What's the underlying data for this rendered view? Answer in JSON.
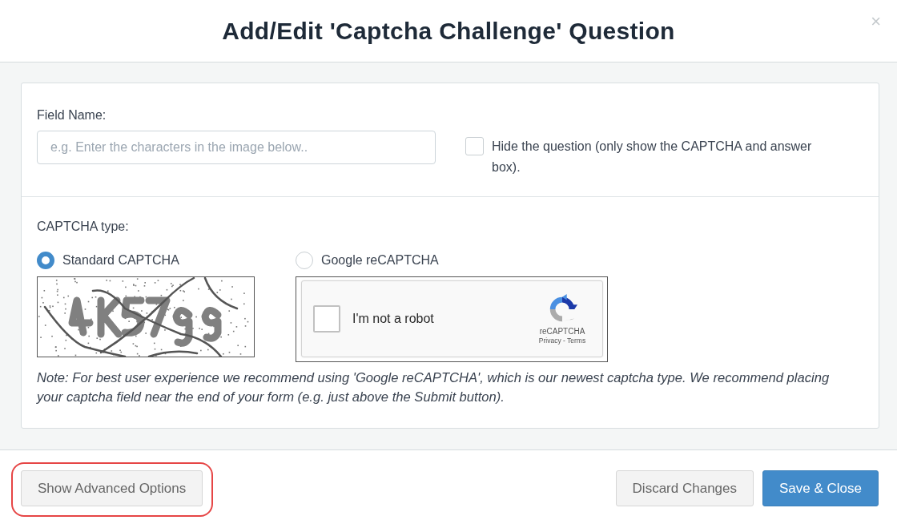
{
  "dialog": {
    "title": "Add/Edit 'Captcha Challenge' Question",
    "close": "×"
  },
  "field_name": {
    "label": "Field Name:",
    "placeholder": "e.g. Enter the characters in the image below.."
  },
  "hide_question": {
    "label": "Hide the question (only show the CAPTCHA and answer box).",
    "checked": false
  },
  "captcha_type": {
    "label": "CAPTCHA type:",
    "options": [
      {
        "label": "Standard CAPTCHA",
        "selected": true,
        "kind": "image"
      },
      {
        "label": "Google reCAPTCHA",
        "selected": false,
        "kind": "recaptcha",
        "widget": {
          "checkbox_label": "I'm not a robot",
          "checked": false,
          "brand": "reCAPTCHA",
          "links": "Privacy - Terms"
        }
      }
    ]
  },
  "note": "Note: For best user experience we recommend using 'Google reCAPTCHA', which is our newest captcha type. We recommend placing your captcha field near the end of your form (e.g. just above the Submit button).",
  "footer": {
    "left_buttons": [
      {
        "label": "Show Advanced Options",
        "kind": "secondary",
        "highlighted": true
      }
    ],
    "right_buttons": [
      {
        "label": "Discard Changes",
        "kind": "secondary",
        "highlighted": false
      },
      {
        "label": "Save & Close",
        "kind": "primary",
        "highlighted": false
      }
    ]
  }
}
